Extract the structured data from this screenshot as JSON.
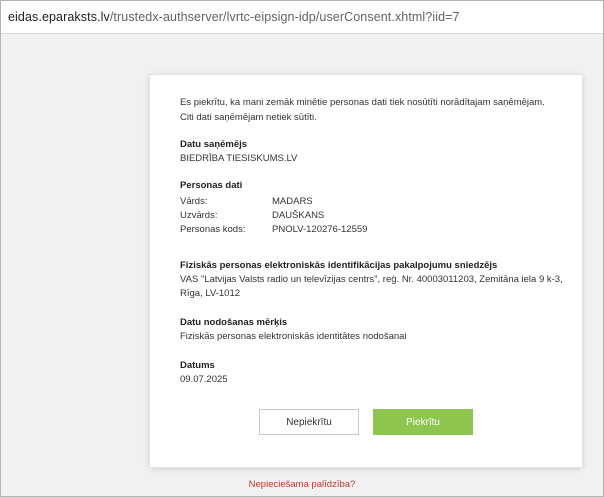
{
  "browser": {
    "url_host": "eidas.eparaksts.lv",
    "url_path": "/trustedx-authserver/lvrtc-eipsign-idp/userConsent.xhtml?iid=7"
  },
  "consent": {
    "intro": "Es piekrītu, ka mani zemāk minētie personas dati tiek nosūtīti norādītajam saņēmējam. Citi dati saņēmējam netiek sūtīti.",
    "recipient": {
      "heading": "Datu saņēmējs",
      "value": "BIEDRĪBA TIESISKUMS.LV"
    },
    "personal": {
      "heading": "Personas dati",
      "rows": [
        {
          "label": "Vārds:",
          "value": "MADARS"
        },
        {
          "label": "Uzvārds:",
          "value": "DAUŠKANS"
        },
        {
          "label": "Personas kods:",
          "value": "PNOLV-120276-12559"
        }
      ]
    },
    "provider": {
      "heading": "Fiziskās personas elektroniskās identifikācijas pakalpojumu sniedzējs",
      "line1": "VAS \"Latvijas Valsts radio un televīzijas centrs\", reģ. Nr. 40003011203, Zemitāna iela 9 k-3,",
      "line2": "Rīga, LV-1012"
    },
    "purpose": {
      "heading": "Datu nodošanas mērķis",
      "value": "Fiziskās personas elektroniskās identitātes nodošanai"
    },
    "date": {
      "heading": "Datums",
      "value": "09.07.2025"
    },
    "buttons": {
      "decline": "Nepiekrītu",
      "accept": "Piekrītu"
    }
  },
  "help_link": "Nepieciešama palīdzība?",
  "colors": {
    "accept_button": "#8dc54f",
    "help_link": "#c0392b"
  }
}
